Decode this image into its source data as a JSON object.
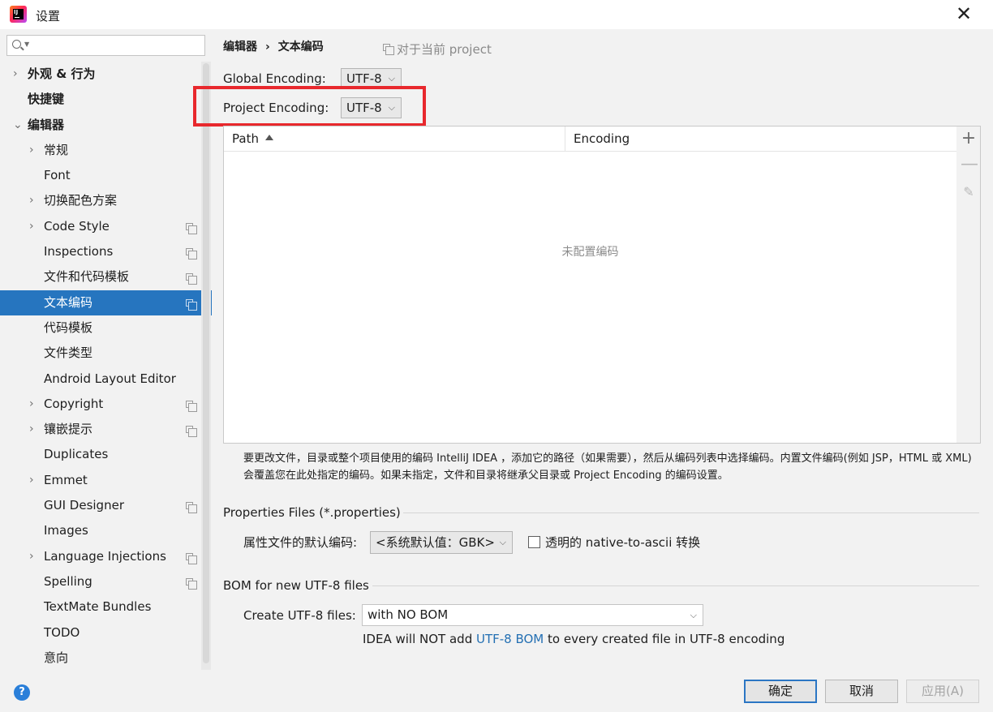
{
  "window": {
    "title": "设置"
  },
  "sidebar": {
    "search_placeholder": "",
    "items": [
      {
        "label": "外观 & 行为",
        "expandable": true
      },
      {
        "label": "快捷键",
        "expandable": false
      },
      {
        "label": "编辑器",
        "expandable": true,
        "expanded": true
      },
      {
        "label": "常规",
        "expandable": true
      },
      {
        "label": "Font",
        "expandable": false
      },
      {
        "label": "切换配色方案",
        "expandable": true
      },
      {
        "label": "Code Style",
        "expandable": true,
        "project_scoped": true
      },
      {
        "label": "Inspections",
        "expandable": false,
        "project_scoped": true
      },
      {
        "label": "文件和代码模板",
        "expandable": false,
        "project_scoped": true
      },
      {
        "label": "文本编码",
        "expandable": false,
        "project_scoped": true,
        "selected": true
      },
      {
        "label": "代码模板",
        "expandable": false
      },
      {
        "label": "文件类型",
        "expandable": false
      },
      {
        "label": "Android Layout Editor",
        "expandable": false
      },
      {
        "label": "Copyright",
        "expandable": true,
        "project_scoped": true
      },
      {
        "label": "镶嵌提示",
        "expandable": true,
        "project_scoped": true
      },
      {
        "label": "Duplicates",
        "expandable": false
      },
      {
        "label": "Emmet",
        "expandable": true
      },
      {
        "label": "GUI Designer",
        "expandable": false,
        "project_scoped": true
      },
      {
        "label": "Images",
        "expandable": false
      },
      {
        "label": "Language Injections",
        "expandable": true,
        "project_scoped": true
      },
      {
        "label": "Spelling",
        "expandable": false,
        "project_scoped": true
      },
      {
        "label": "TextMate Bundles",
        "expandable": false
      },
      {
        "label": "TODO",
        "expandable": false
      },
      {
        "label": "意向",
        "expandable": false
      }
    ]
  },
  "main": {
    "breadcrumb": {
      "parent": "编辑器",
      "separator": "›",
      "current": "文本编码"
    },
    "scope_label": "对于当前 project",
    "global_encoding": {
      "label": "Global Encoding:",
      "value": "UTF-8"
    },
    "project_encoding": {
      "label": "Project Encoding:",
      "value": "UTF-8"
    },
    "table": {
      "columns": [
        "Path",
        "Encoding"
      ],
      "sort_column": "Path",
      "sort_direction": "ascending",
      "empty_text": "未配置编码",
      "tools": {
        "add": "+",
        "remove": "—",
        "edit": "✎"
      }
    },
    "description_line1": "要更改文件，目录或整个项目使用的编码 IntelliJ IDEA ，添加它的路径（如果需要），然后从编码列表中选择编码。内置文件编码(例如 JSP，HTML 或 XML)",
    "description_line2": "会覆盖您在此处指定的编码。如果未指定，文件和目录将继承父目录或 Project Encoding 的编码设置。",
    "properties": {
      "section_title": "Properties Files (*.properties)",
      "default_label": "属性文件的默认编码:",
      "default_value": "<系统默认值：GBK>",
      "native_checkbox_label": "透明的 native-to-ascii 转换",
      "native_checked": false
    },
    "bom": {
      "section_title": "BOM for new UTF-8 files",
      "create_label": "Create UTF-8 files:",
      "create_value": "with NO BOM",
      "hint_prefix": "IDEA will NOT add ",
      "hint_link": "UTF-8 BOM",
      "hint_suffix": " to every created file in UTF-8 encoding"
    }
  },
  "footer": {
    "help_icon": "?",
    "ok": "确定",
    "cancel": "取消",
    "apply": "应用(A)"
  },
  "colors": {
    "selection": "#2675bf",
    "highlight_box": "#e8282d",
    "link": "#2470b3",
    "default_button_border": "#2b76c4"
  }
}
